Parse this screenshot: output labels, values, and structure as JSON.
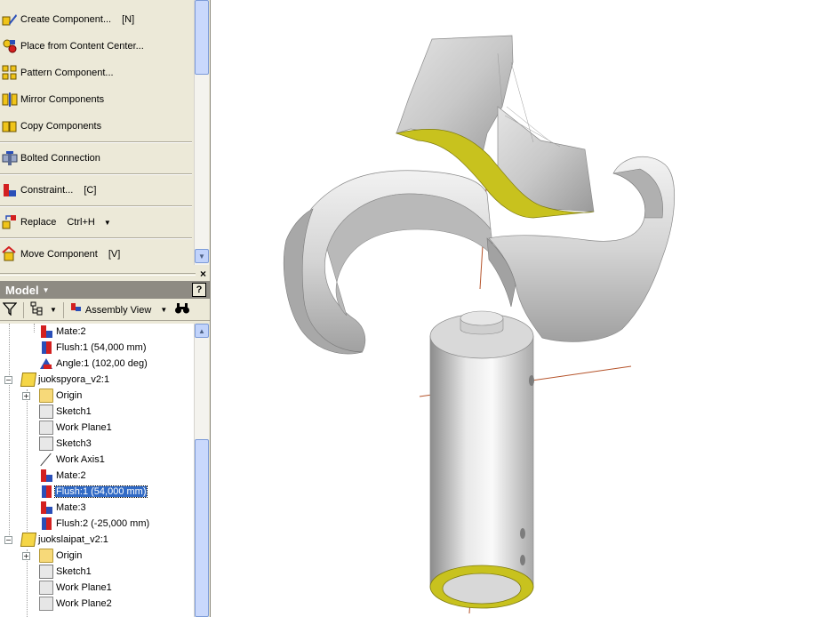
{
  "panel_bar": {
    "commands": [
      {
        "label": "Create Component...",
        "shortcut": "[N]",
        "icon": "create-component-icon"
      },
      {
        "label": "Place from Content Center...",
        "shortcut": "",
        "icon": "content-center-icon"
      },
      {
        "label": "Pattern Component...",
        "shortcut": "",
        "icon": "pattern-component-icon"
      },
      {
        "label": "Mirror Components",
        "shortcut": "",
        "icon": "mirror-components-icon"
      },
      {
        "label": "Copy Components",
        "shortcut": "",
        "icon": "copy-components-icon"
      },
      {
        "label": "Bolted Connection",
        "shortcut": "",
        "icon": "bolted-connection-icon"
      },
      {
        "label": "Constraint...",
        "shortcut": "[C]",
        "icon": "constraint-icon"
      },
      {
        "label": "Replace",
        "shortcut": "Ctrl+H",
        "icon": "replace-icon"
      },
      {
        "label": "Move Component",
        "shortcut": "[V]",
        "icon": "move-component-icon"
      }
    ]
  },
  "browser": {
    "title": "Model",
    "help": "?",
    "view_mode": "Assembly View",
    "tree": [
      {
        "label": "Mate:2",
        "icon": "mate"
      },
      {
        "label": "Flush:1 (54,000 mm)",
        "icon": "flush"
      },
      {
        "label": "Angle:1 (102,00 deg)",
        "icon": "angle"
      },
      {
        "label": "juokspyora_v2:1",
        "icon": "part"
      },
      {
        "label": "Origin",
        "icon": "folder"
      },
      {
        "label": "Sketch1",
        "icon": "sketch"
      },
      {
        "label": "Work Plane1",
        "icon": "plane"
      },
      {
        "label": "Sketch3",
        "icon": "sketch"
      },
      {
        "label": "Work Axis1",
        "icon": "axis"
      },
      {
        "label": "Mate:2",
        "icon": "mate"
      },
      {
        "label": "Flush:1 (54,000 mm)",
        "icon": "flush",
        "selected": true
      },
      {
        "label": "Mate:3",
        "icon": "mate"
      },
      {
        "label": "Flush:2 (-25,000 mm)",
        "icon": "flush"
      },
      {
        "label": "juokslaipat_v2:1",
        "icon": "part"
      },
      {
        "label": "Origin",
        "icon": "folder"
      },
      {
        "label": "Sketch1",
        "icon": "sketch"
      },
      {
        "label": "Work Plane1",
        "icon": "plane"
      },
      {
        "label": "Work Plane2",
        "icon": "plane"
      }
    ]
  },
  "colors": {
    "accent_face": "#c8c21e",
    "selection": "#316ac5",
    "axis": "#b5532a"
  }
}
